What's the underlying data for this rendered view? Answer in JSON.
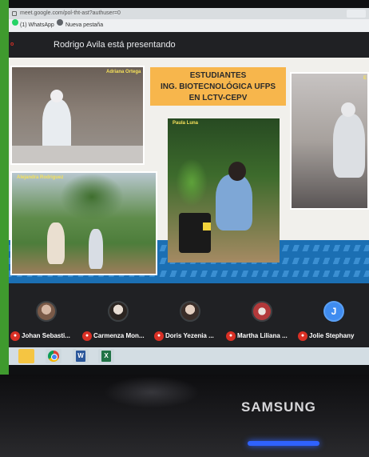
{
  "browser": {
    "url": "meet.google.com/pol-tht-ast?authuser=0",
    "bookmarks": [
      {
        "label": "(1) WhatsApp",
        "icon": "whatsapp-icon"
      },
      {
        "label": "Nueva pestaña",
        "icon": "globe-icon"
      }
    ]
  },
  "meet": {
    "presenting_text": "Rodrigo Avila está presentando"
  },
  "slide": {
    "title_lines": [
      "ESTUDIANTES",
      "ING. BIOTECNOLÓGICA UFPS",
      "EN LCTV-CEPV"
    ],
    "captions": {
      "lab": "Adriana Ortega",
      "palm": "Alejandra Rodriguez",
      "plant": "Paula Luna",
      "hood": "E"
    }
  },
  "participants": [
    {
      "name": "Johan Sebasti...",
      "muted": true
    },
    {
      "name": "Carmenza Mon...",
      "muted": true
    },
    {
      "name": "Doris Yezenia ...",
      "muted": true
    },
    {
      "name": "Martha Liliana ...",
      "muted": true
    },
    {
      "name": "Jolie Stephany",
      "muted": true,
      "initial": "J"
    }
  ],
  "taskbar": {
    "apps": [
      {
        "icon": "file-explorer-icon"
      },
      {
        "icon": "chrome-icon"
      },
      {
        "icon": "word-icon",
        "label": "W"
      },
      {
        "icon": "excel-icon",
        "label": "X"
      }
    ]
  },
  "monitor": {
    "brand": "SAMSUNG"
  },
  "colors": {
    "meet_bar": "#202124",
    "slide_title_bg": "#f7b64c",
    "slide_band": "#1b6fb3",
    "mute_red": "#d93025",
    "avatar_blue": "#3f8cf0"
  }
}
